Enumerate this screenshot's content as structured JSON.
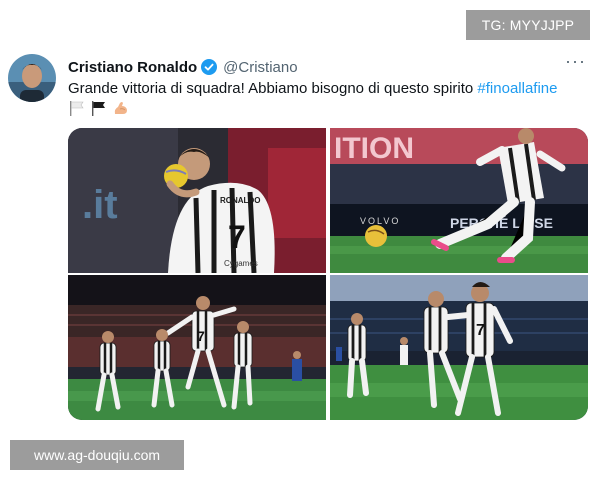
{
  "overlays": {
    "top_badge": "TG: MYYJJPP",
    "bottom_badge": "www.ag-douqiu.com"
  },
  "tweet": {
    "author_name": "Cristiano Ronaldo",
    "verified": true,
    "handle": "@Cristiano",
    "more_label": "···",
    "text": "Grande vittoria di squadra! Abbiamo bisogno di questo spirito",
    "hashtag": "#finoallafine",
    "emojis": [
      "white-flag-icon",
      "black-flag-icon",
      "flexed-biceps-icon"
    ],
    "photos": {
      "photo1": {
        "jersey_name": "RONALDO",
        "jersey_number": "7",
        "sponsor": "Cygames",
        "backdrop_text": ".it"
      },
      "photo2": {
        "banner_text": "ITION",
        "board_left": "VOLVO",
        "board_right": "PERCHÉ LA SE"
      },
      "photo3": {
        "jersey_number": "7"
      },
      "photo4": {
        "jersey_number": "7"
      }
    }
  },
  "colors": {
    "link": "#1d9bf0",
    "verified": "#1d9bf0",
    "badge_bg": "#9c9c9c"
  }
}
